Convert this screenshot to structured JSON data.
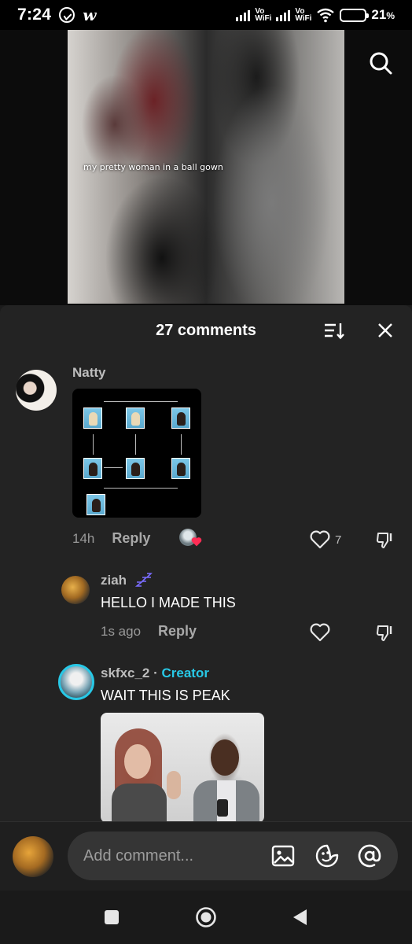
{
  "status_bar": {
    "time": "7:24",
    "app_glyph": "w",
    "vowifi_1": "Vo\nWiFi",
    "vowifi_2": "Vo\nWiFi",
    "battery_percent": "21",
    "battery_unit": "%",
    "battery_level": 0.21
  },
  "video": {
    "caption": "my pretty woman in a ball gown"
  },
  "comments_sheet": {
    "title": "27 comments",
    "comments": [
      {
        "user": "Natty",
        "time": "14h",
        "reply_label": "Reply",
        "likes": "7",
        "has_image": true
      },
      {
        "user": "ziah",
        "user_badge": "zzz-icon",
        "text": "HELLO I MADE THIS",
        "time": "1s ago",
        "reply_label": "Reply"
      },
      {
        "user": "skfxc_2",
        "separator": " · ",
        "role": "Creator",
        "text": "WAIT THIS IS PEAK",
        "has_image": true
      }
    ]
  },
  "input_bar": {
    "placeholder": "Add comment..."
  },
  "icons": {
    "search": "search-icon",
    "sort": "sort-icon",
    "close": "close-icon",
    "like": "heart-icon",
    "dislike": "thumbs-down-icon",
    "image": "image-icon",
    "sticker": "sticker-icon",
    "mention": "at-icon"
  },
  "colors": {
    "background": "#1c1c1c",
    "sheet": "#232323",
    "creator_accent": "#28c8e6",
    "battery_low": "#f0a020",
    "like_badge_heart": "#ff2d55"
  }
}
